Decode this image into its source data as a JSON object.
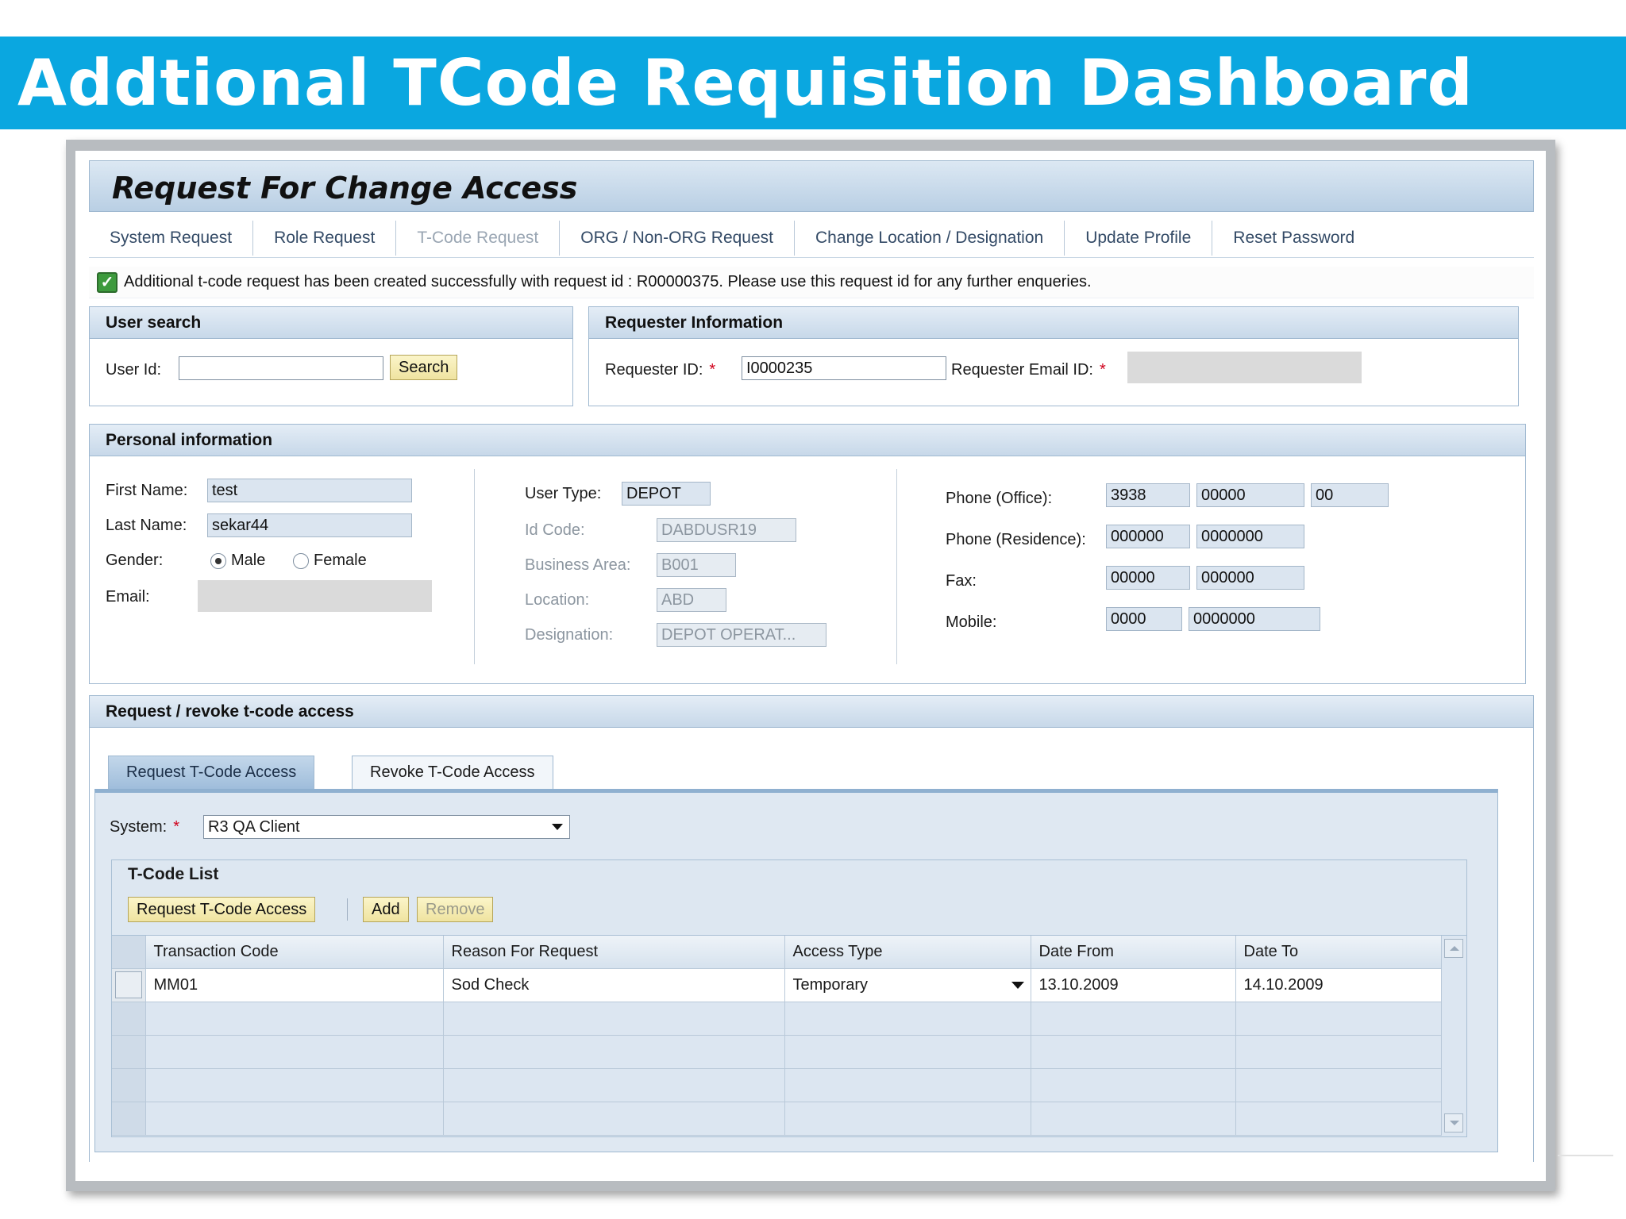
{
  "banner": {
    "title": "Addtional TCode Requisition Dashboard"
  },
  "app": {
    "title": "Request For Change Access"
  },
  "nav": [
    "System Request",
    "Role Request",
    "T-Code Request",
    "ORG / Non-ORG Request",
    "Change Location / Designation",
    "Update Profile",
    "Reset Password"
  ],
  "nav_active": "T-Code Request",
  "message": {
    "icon": "checkbox-checked-icon",
    "text": "Additional t-code request has been created successfully with request id : R00000375. Please use this request id for any further enqueries."
  },
  "user_search": {
    "title": "User search",
    "user_id_label": "User Id:",
    "user_id_value": "",
    "search_label": "Search"
  },
  "requester": {
    "title": "Requester Information",
    "id_label": "Requester ID:",
    "required_mark": "*",
    "id_value": "I0000235",
    "email_label": "Requester Email ID:",
    "email_value": ""
  },
  "personal": {
    "title": "Personal information",
    "first_name_label": "First Name:",
    "first_name": "test",
    "last_name_label": "Last Name:",
    "last_name": "sekar44",
    "gender_label": "Gender:",
    "gender_male": "Male",
    "gender_female": "Female",
    "gender_selected": "Male",
    "email_label": "Email:",
    "email": "",
    "user_type_label": "User Type:",
    "user_type": "DEPOT",
    "id_code_label": "Id Code:",
    "id_code": "DABDUSR19",
    "business_area_label": "Business Area:",
    "business_area": "B001",
    "location_label": "Location:",
    "location": "ABD",
    "designation_label": "Designation:",
    "designation": "DEPOT OPERAT...",
    "phone_office_label": "Phone (Office):",
    "phone_office": [
      "3938",
      "00000",
      "00"
    ],
    "phone_residence_label": "Phone (Residence):",
    "phone_residence": [
      "000000",
      "0000000"
    ],
    "fax_label": "Fax:",
    "fax": [
      "00000",
      "000000"
    ],
    "mobile_label": "Mobile:",
    "mobile": [
      "0000",
      "0000000"
    ]
  },
  "access": {
    "title": "Request / revoke t-code access",
    "tabs": [
      "Request T-Code Access",
      "Revoke T-Code Access"
    ],
    "active_tab": "Request T-Code Access",
    "system_label": "System:",
    "required_mark": "*",
    "system_value": "R3 QA Client",
    "tcode_list": {
      "title": "T-Code List",
      "buttons": {
        "request": "Request T-Code Access",
        "add": "Add",
        "remove": "Remove"
      },
      "columns": [
        "Transaction Code",
        "Reason For Request",
        "Access Type",
        "Date From",
        "Date To"
      ],
      "rows": [
        [
          "MM01",
          "Sod Check",
          "Temporary",
          "13.10.2009",
          "14.10.2009"
        ]
      ],
      "empty_rows": 4
    }
  },
  "colors": {
    "banner": "#0aa7e0",
    "panel_header": "#c7d8e9",
    "button": "#efe3a0",
    "required": "#d0001b",
    "success": "#3d9a3d"
  }
}
